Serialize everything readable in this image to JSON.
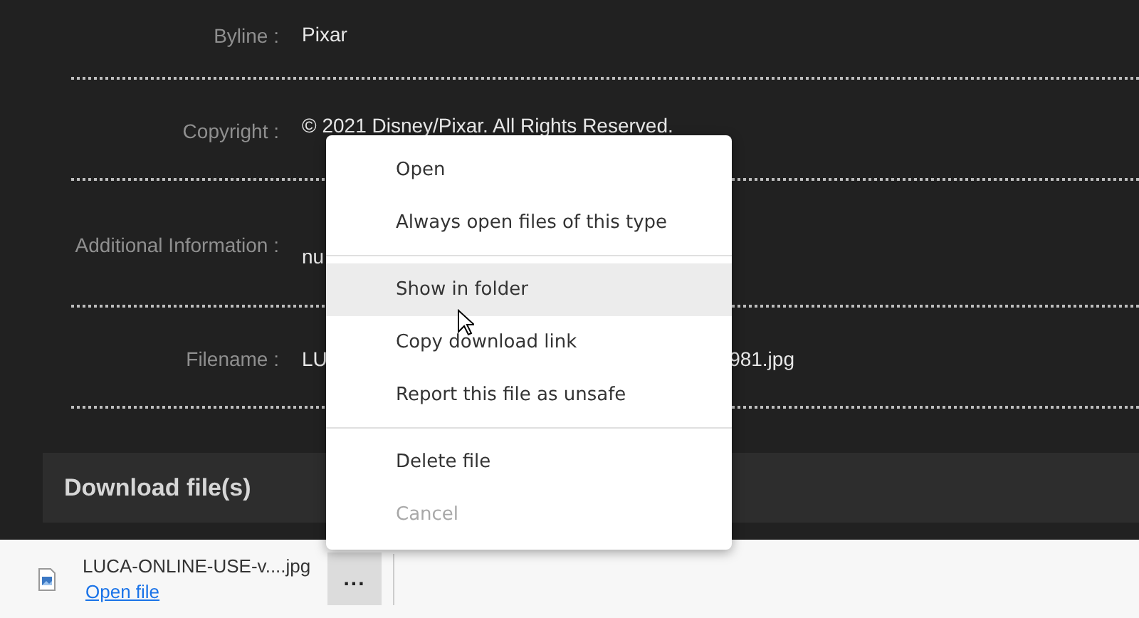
{
  "details": [
    {
      "label": "Byline :",
      "value": "Pixar"
    },
    {
      "label": "Copyright :",
      "value": "© 2021 Disney/Pixar. All Rights Reserved."
    },
    {
      "label": "Additional Information :",
      "value": "nu"
    },
    {
      "label": "Filename :",
      "value": "LU",
      "value_end": "981.jpg"
    }
  ],
  "download_heading": "Download file(s)",
  "context_menu": [
    {
      "label": "Open",
      "hovered": false,
      "disabled": false,
      "separator_after": false
    },
    {
      "label": "Always open files of this type",
      "hovered": false,
      "disabled": false,
      "separator_after": true
    },
    {
      "label": "Show in folder",
      "hovered": true,
      "disabled": false,
      "separator_after": false
    },
    {
      "label": "Copy download link",
      "hovered": false,
      "disabled": false,
      "separator_after": false
    },
    {
      "label": "Report this file as unsafe",
      "hovered": false,
      "disabled": false,
      "separator_after": true
    },
    {
      "label": "Delete file",
      "hovered": false,
      "disabled": false,
      "separator_after": false
    },
    {
      "label": "Cancel",
      "hovered": false,
      "disabled": true,
      "separator_after": false
    }
  ],
  "download_shelf": {
    "filename": "LUCA-ONLINE-USE-v....jpg",
    "link": "Open file",
    "more_button": "...",
    "more_active": true
  }
}
